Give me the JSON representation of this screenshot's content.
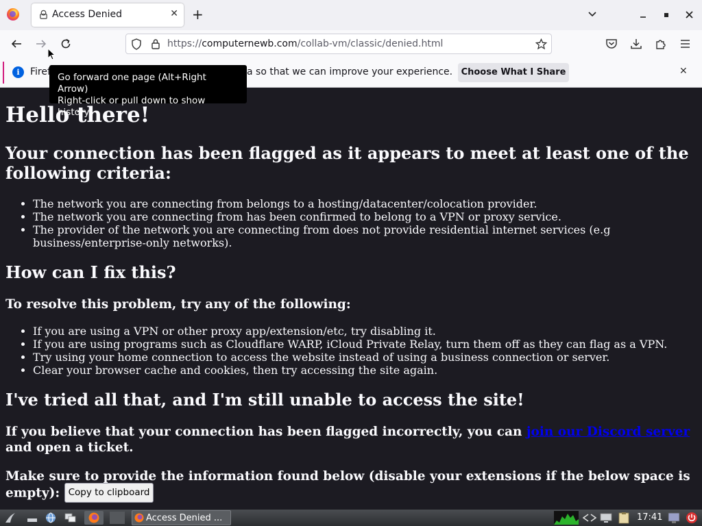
{
  "browser": {
    "tab": {
      "title": "Access Denied"
    },
    "url": {
      "prefix": "https://",
      "host": "computernewb.com",
      "path": "/collab-vm/classic/denied.html"
    },
    "notification": {
      "text_left": "Firef",
      "text_right": "a so that we can improve your experience.",
      "button_label": "Choose What I Share"
    },
    "tooltip": {
      "line1": "Go forward one page (Alt+Right Arrow)",
      "line2": "Right-click or pull down to show history"
    }
  },
  "page": {
    "heading": "Hello there!",
    "criteria_heading": "Your connection has been flagged as it appears to meet at least one of the following criteria:",
    "criteria": [
      "The network you are connecting from belongs to a hosting/datacenter/colocation provider.",
      "The network you are connecting from has been confirmed to belong to a VPN or proxy service.",
      "The provider of the network you are connecting from does not provide residential internet services (e.g business/enterprise-only networks)."
    ],
    "fix_heading": "How can I fix this?",
    "fix_subheading": "To resolve this problem, try any of the following:",
    "fixes": [
      "If you are using a VPN or other proxy app/extension/etc, try disabling it.",
      "If you are using programs such as Cloudflare WARP, iCloud Private Relay, turn them off as they can flag as a VPN.",
      "Try using your home connection to access the website instead of using a business connection or server.",
      "Clear your browser cache and cookies, then try accessing the site again."
    ],
    "still_heading": "I've tried all that, and I'm still unable to access the site!",
    "flagged_text_before": "If you believe that your connection has been flagged incorrectly, you can ",
    "flagged_link": "join our Discord server",
    "flagged_text_after": " and open a ticket.",
    "info_text": "Make sure to provide the information found below (disable your extensions if the below space is empty):",
    "copy_button": "Copy to clipboard"
  },
  "taskbar": {
    "task_label": "Access Denied ...",
    "clock": "17:41"
  },
  "colors": {
    "page_background": "#1c1b22",
    "link": "#0000ee",
    "notification_accent": "#d21b7d",
    "info_icon": "#0061e0"
  }
}
